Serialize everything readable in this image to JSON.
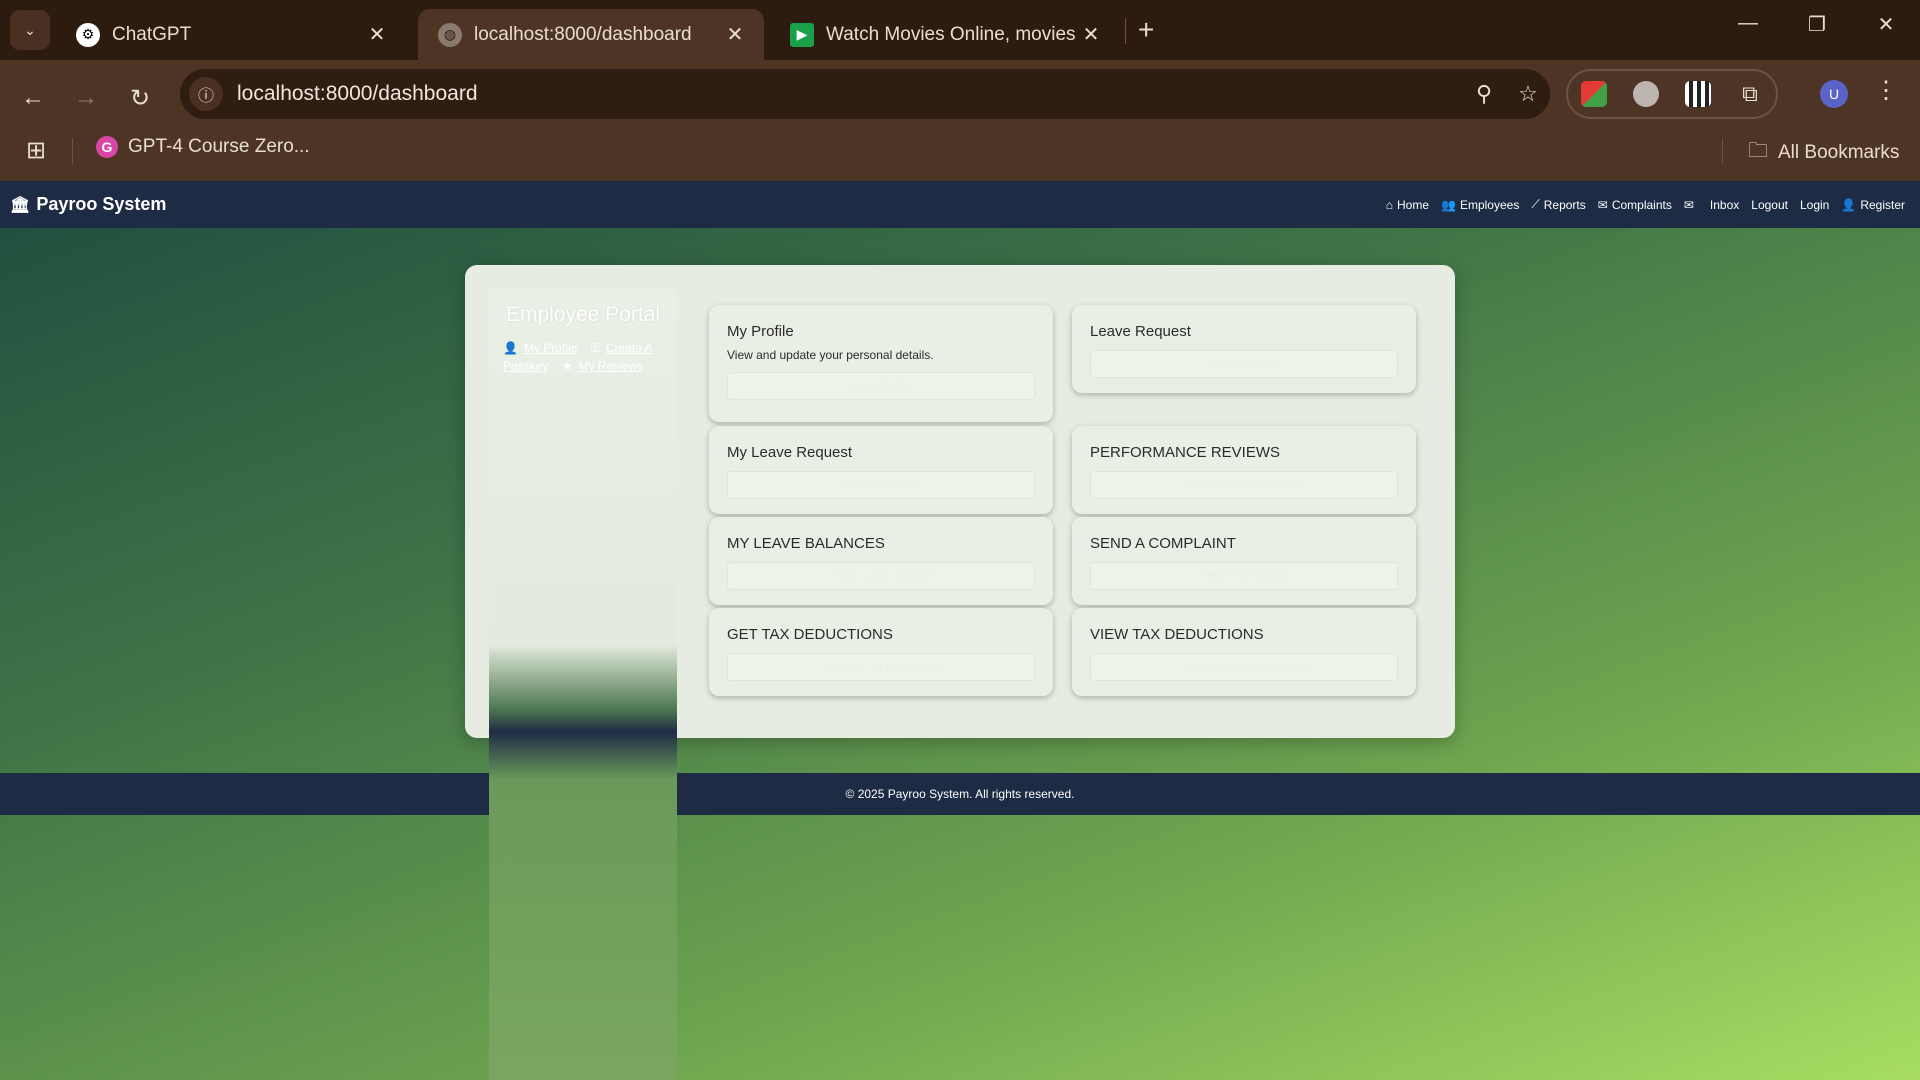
{
  "browser": {
    "tabs": [
      {
        "title": "ChatGPT",
        "icon": "chatgpt-icon"
      },
      {
        "title": "localhost:8000/dashboard",
        "icon": "globe-icon"
      },
      {
        "title": "Watch Movies Online, movies s",
        "icon": "play-icon"
      }
    ],
    "url": "localhost:8000/dashboard",
    "bookmarks": [
      {
        "label": "GPT-4 Course Zero..."
      }
    ],
    "all_bookmarks_label": "All Bookmarks",
    "avatar_letter": "U"
  },
  "app": {
    "brand": "Payroo System",
    "nav": [
      {
        "label": "Home",
        "icon": "home-icon"
      },
      {
        "label": "Employees",
        "icon": "users-icon"
      },
      {
        "label": "Reports",
        "icon": "chart-icon"
      },
      {
        "label": "Complaints",
        "icon": "envelope-icon"
      },
      {
        "label": "",
        "icon": "mail-icon"
      },
      {
        "label": "Inbox",
        "icon": ""
      },
      {
        "label": "Logout",
        "icon": ""
      },
      {
        "label": "Login",
        "icon": ""
      },
      {
        "label": "Register",
        "icon": "user-plus-icon"
      }
    ]
  },
  "sidebar": {
    "title": "Employee Portal",
    "links": [
      "My Profile",
      "Create A Passkey",
      "My Reviews"
    ]
  },
  "cards": [
    {
      "title": "My Profile",
      "desc": "View and update your personal details.",
      "button": "Go to Profile"
    },
    {
      "title": "Leave Request",
      "desc": "",
      "button": "Request Leave"
    },
    {
      "title": "My Leave Request",
      "desc": "",
      "button": "Leave Requests"
    },
    {
      "title": "PERFORMANCE REVIEWS",
      "desc": "",
      "button": "My Performance Ratings"
    },
    {
      "title": "MY LEAVE BALANCES",
      "desc": "",
      "button": "Check Leave Balance"
    },
    {
      "title": "SEND A COMPLAINT",
      "desc": "",
      "button": "Send a Complaint"
    },
    {
      "title": "GET TAX DEDUCTIONS",
      "desc": "",
      "button": "Get your Tax Deductions"
    },
    {
      "title": "VIEW TAX DEDUCTIONS",
      "desc": "",
      "button": "View your Tax Deductions"
    }
  ],
  "footer": {
    "text": "© 2025 Payroo System. All rights reserved."
  }
}
